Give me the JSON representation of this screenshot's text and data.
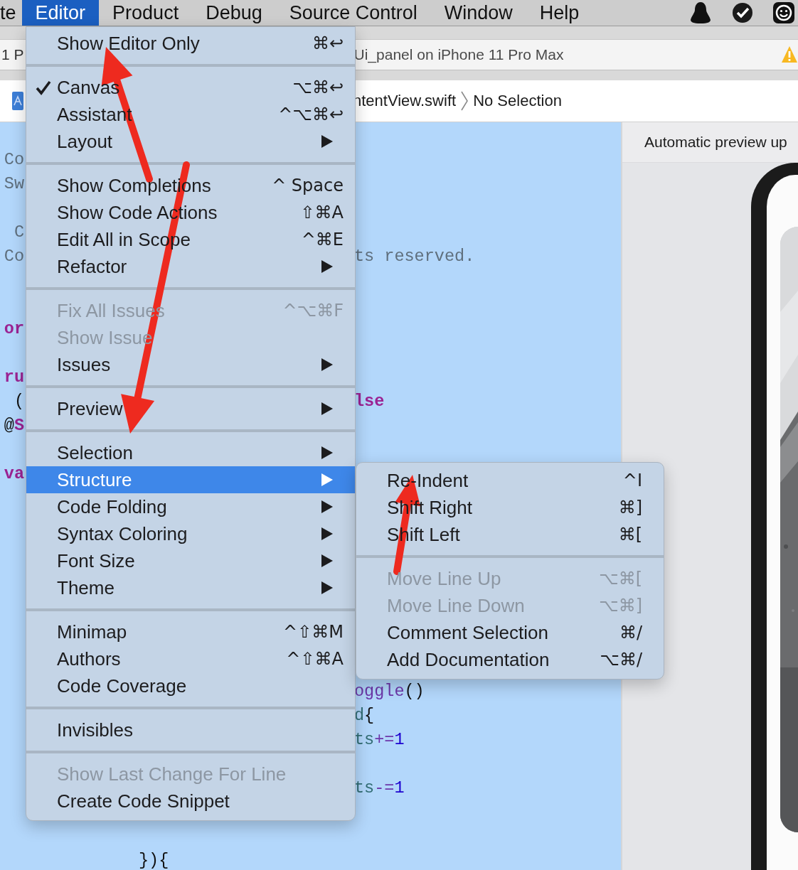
{
  "menubar": {
    "items": [
      {
        "label": "te",
        "selected": false
      },
      {
        "label": "Editor",
        "selected": true
      },
      {
        "label": "Product",
        "selected": false
      },
      {
        "label": "Debug",
        "selected": false
      },
      {
        "label": "Source Control",
        "selected": false
      },
      {
        "label": "Window",
        "selected": false
      },
      {
        "label": "Help",
        "selected": false
      }
    ]
  },
  "toolbar": {
    "scheme": "1 P",
    "status": "Ui_panel on iPhone 11 Pro Max"
  },
  "jump_bar": {
    "file": "ntentView.swift",
    "selection": "No Selection"
  },
  "code": {
    "lines": [
      {
        "kind": "split",
        "left": [
          {
            "text": "Co",
            "kind": "comment"
          }
        ]
      },
      {
        "kind": "split",
        "left": [
          {
            "text": "Sw",
            "kind": "comment"
          }
        ]
      },
      {
        "kind": "blank"
      },
      {
        "kind": "split",
        "left": [
          {
            "text": "C",
            "kind": "comment"
          }
        ]
      },
      {
        "kind": "split",
        "left": [
          {
            "text": "Co",
            "kind": "comment"
          }
        ],
        "right": [
          {
            "text": "ts reserved.",
            "kind": "comment"
          }
        ]
      },
      {
        "kind": "blank"
      },
      {
        "kind": "blank"
      },
      {
        "kind": "split",
        "left": [
          {
            "text": "or",
            "kind": "keyword"
          }
        ]
      },
      {
        "kind": "blank"
      },
      {
        "kind": "split",
        "left": [
          {
            "text": "ru",
            "kind": "keyword"
          }
        ]
      },
      {
        "kind": "split",
        "left": [
          {
            "text": "(",
            "kind": "plain"
          }
        ],
        "right": [
          {
            "text": "lse",
            "kind": "keyword"
          }
        ]
      },
      {
        "kind": "split",
        "left": [
          {
            "text": "@",
            "kind": "plain"
          },
          {
            "text": "S",
            "kind": "keyword"
          }
        ]
      },
      {
        "kind": "blank"
      },
      {
        "kind": "split",
        "left": [
          {
            "text": "va",
            "kind": "keyword"
          }
        ]
      },
      {
        "kind": "blank"
      },
      {
        "kind": "blank"
      },
      {
        "kind": "blank"
      },
      {
        "kind": "blank"
      },
      {
        "kind": "blank"
      },
      {
        "kind": "blank"
      },
      {
        "kind": "blank"
      },
      {
        "kind": "blank"
      },
      {
        "kind": "split",
        "right": [
          {
            "text": "oggle",
            "kind": "method"
          },
          {
            "text": "()",
            "kind": "plain"
          }
        ]
      },
      {
        "kind": "split",
        "right": [
          {
            "text": "d",
            "kind": "ident"
          },
          {
            "text": "{",
            "kind": "plain"
          }
        ]
      },
      {
        "kind": "split",
        "right": [
          {
            "text": "ts",
            "kind": "ident"
          },
          {
            "text": "+=",
            "kind": "method"
          },
          {
            "text": "1",
            "kind": "number"
          }
        ]
      },
      {
        "kind": "blank"
      },
      {
        "kind": "split",
        "right": [
          {
            "text": "ts",
            "kind": "ident"
          },
          {
            "text": "-=",
            "kind": "method"
          },
          {
            "text": "1",
            "kind": "number"
          }
        ]
      },
      {
        "kind": "blank"
      },
      {
        "kind": "blank"
      },
      {
        "kind": "indented",
        "text": [
          {
            "text": "}){",
            "kind": "plain"
          }
        ]
      }
    ]
  },
  "preview": {
    "banner": "Automatic preview up"
  },
  "menu": {
    "groups": [
      {
        "items": [
          {
            "label": "Show Editor Only",
            "shortcut": "⌘↩",
            "submenu": false,
            "checked": false,
            "disabled": false,
            "selected": false
          }
        ]
      },
      {
        "items": [
          {
            "label": "Canvas",
            "shortcut": "⌥⌘↩",
            "submenu": false,
            "checked": true,
            "disabled": false,
            "selected": false
          },
          {
            "label": "Assistant",
            "shortcut": "^⌥⌘↩",
            "submenu": false,
            "checked": false,
            "disabled": false,
            "selected": false
          },
          {
            "label": "Layout",
            "submenu": true,
            "checked": false,
            "disabled": false,
            "selected": false
          }
        ]
      },
      {
        "items": [
          {
            "label": "Show Completions",
            "shortcut": "^ Space",
            "submenu": false,
            "checked": false,
            "disabled": false,
            "selected": false
          },
          {
            "label": "Show Code Actions",
            "shortcut": "⇧⌘A",
            "submenu": false,
            "checked": false,
            "disabled": false,
            "selected": false
          },
          {
            "label": "Edit All in Scope",
            "shortcut": "^⌘E",
            "submenu": false,
            "checked": false,
            "disabled": false,
            "selected": false
          },
          {
            "label": "Refactor",
            "submenu": true,
            "checked": false,
            "disabled": false,
            "selected": false
          }
        ]
      },
      {
        "items": [
          {
            "label": "Fix All Issues",
            "shortcut": "^⌥⌘F",
            "submenu": false,
            "checked": false,
            "disabled": true,
            "selected": false
          },
          {
            "label": "Show Issue",
            "submenu": false,
            "checked": false,
            "disabled": true,
            "selected": false
          },
          {
            "label": "Issues",
            "submenu": true,
            "checked": false,
            "disabled": false,
            "selected": false
          }
        ]
      },
      {
        "items": [
          {
            "label": "Preview",
            "submenu": true,
            "checked": false,
            "disabled": false,
            "selected": false
          }
        ]
      },
      {
        "items": [
          {
            "label": "Selection",
            "submenu": true,
            "checked": false,
            "disabled": false,
            "selected": false
          },
          {
            "label": "Structure",
            "submenu": true,
            "checked": false,
            "disabled": false,
            "selected": true
          },
          {
            "label": "Code Folding",
            "submenu": true,
            "checked": false,
            "disabled": false,
            "selected": false
          },
          {
            "label": "Syntax Coloring",
            "submenu": true,
            "checked": false,
            "disabled": false,
            "selected": false
          },
          {
            "label": "Font Size",
            "submenu": true,
            "checked": false,
            "disabled": false,
            "selected": false
          },
          {
            "label": "Theme",
            "submenu": true,
            "checked": false,
            "disabled": false,
            "selected": false
          }
        ]
      },
      {
        "items": [
          {
            "label": "Minimap",
            "shortcut": "^⇧⌘M",
            "submenu": false,
            "checked": false,
            "disabled": false,
            "selected": false
          },
          {
            "label": "Authors",
            "shortcut": "^⇧⌘A",
            "submenu": false,
            "checked": false,
            "disabled": false,
            "selected": false
          },
          {
            "label": "Code Coverage",
            "submenu": false,
            "checked": false,
            "disabled": false,
            "selected": false
          }
        ]
      },
      {
        "items": [
          {
            "label": "Invisibles",
            "submenu": false,
            "checked": false,
            "disabled": false,
            "selected": false
          }
        ]
      },
      {
        "items": [
          {
            "label": "Show Last Change For Line",
            "submenu": false,
            "checked": false,
            "disabled": true,
            "selected": false
          },
          {
            "label": "Create Code Snippet",
            "submenu": false,
            "checked": false,
            "disabled": false,
            "selected": false
          }
        ]
      }
    ]
  },
  "submenu": {
    "groups": [
      {
        "items": [
          {
            "label": "Re-Indent",
            "shortcut": "^I",
            "submenu": false,
            "checked": false,
            "disabled": false,
            "selected": false
          },
          {
            "label": "Shift Right",
            "shortcut": "⌘]",
            "submenu": false,
            "checked": false,
            "disabled": false,
            "selected": false
          },
          {
            "label": "Shift Left",
            "shortcut": "⌘[",
            "submenu": false,
            "checked": false,
            "disabled": false,
            "selected": false
          }
        ]
      },
      {
        "items": [
          {
            "label": "Move Line Up",
            "shortcut": "⌥⌘[",
            "submenu": false,
            "checked": false,
            "disabled": true,
            "selected": false
          },
          {
            "label": "Move Line Down",
            "shortcut": "⌥⌘]",
            "submenu": false,
            "checked": false,
            "disabled": true,
            "selected": false
          },
          {
            "label": "Comment Selection",
            "shortcut": "⌘/",
            "submenu": false,
            "checked": false,
            "disabled": false,
            "selected": false
          },
          {
            "label": "Add Documentation",
            "shortcut": "⌥⌘/",
            "submenu": false,
            "checked": false,
            "disabled": false,
            "selected": false
          }
        ]
      }
    ]
  }
}
